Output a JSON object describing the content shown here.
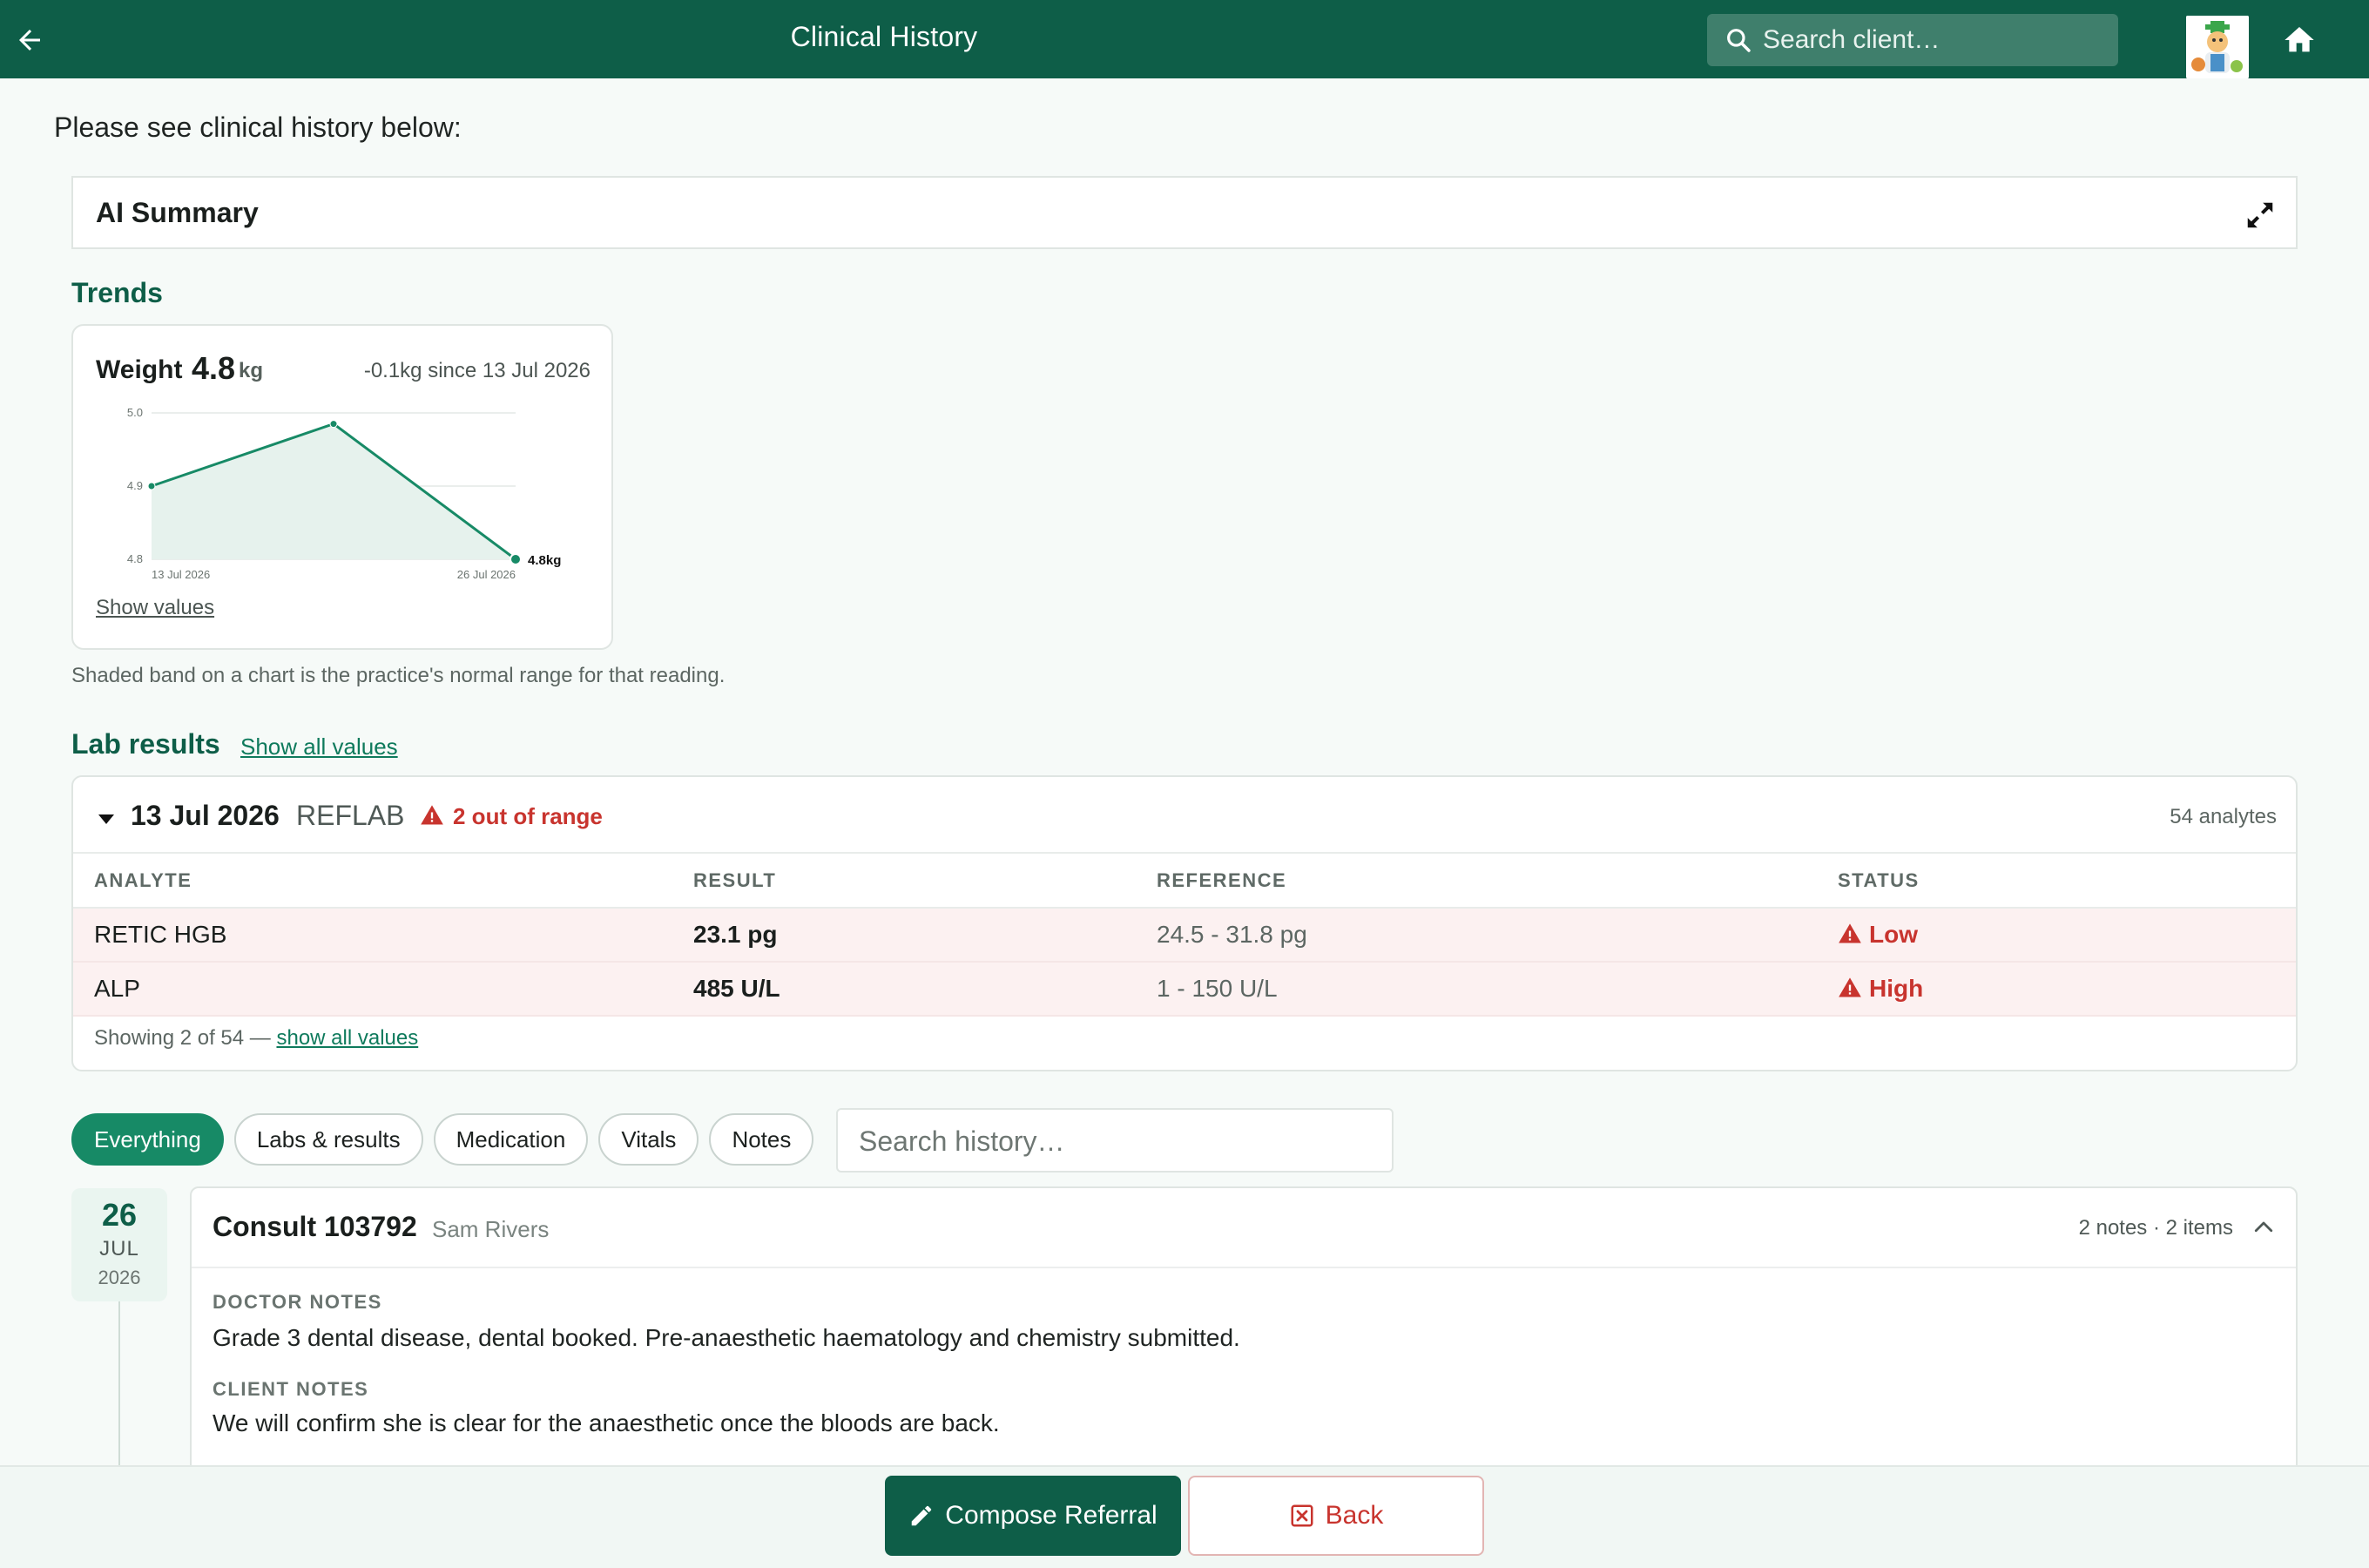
{
  "header": {
    "title": "Clinical History",
    "search_placeholder": "Search client…"
  },
  "intro": "Please see clinical history below:",
  "ai_summary": {
    "label": "AI Summary"
  },
  "trends": {
    "title": "Trends",
    "weight": {
      "label": "Weight",
      "value": "4.8",
      "unit": "kg",
      "delta": "-0.1kg since 13 Jul 2026",
      "show_values": "Show values",
      "end_label": "4.8kg"
    },
    "footnote": "Shaded band on a chart is the practice's normal range for that reading."
  },
  "chart_data": {
    "type": "line",
    "x": [
      "13 Jul 2026",
      "19 Jul 2026",
      "26 Jul 2026"
    ],
    "series": [
      {
        "values": [
          4.9,
          4.985,
          4.8
        ]
      }
    ],
    "ylim": [
      4.8,
      5.0
    ],
    "yticks": [
      "5.0",
      "4.9",
      "4.8"
    ],
    "xtick_labels": [
      "13 Jul 2026",
      "26 Jul 2026"
    ],
    "grid": true,
    "normal_range_band": true,
    "color": "#178a66"
  },
  "lab_results": {
    "title": "Lab results",
    "show_all": "Show all values",
    "panel": {
      "date": "13 Jul 2026",
      "source": "REFLAB",
      "out_of_range": "2 out of range",
      "analyte_count": "54 analytes",
      "columns": [
        "ANALYTE",
        "RESULT",
        "REFERENCE",
        "STATUS"
      ],
      "rows": [
        {
          "analyte": "RETIC HGB",
          "result": "23.1 pg",
          "reference": "24.5 - 31.8 pg",
          "status": "Low"
        },
        {
          "analyte": "ALP",
          "result": "485 U/L",
          "reference": "1 - 150 U/L",
          "status": "High"
        }
      ],
      "showing": "Showing 2 of 54 —",
      "show_all_lower": "show all values"
    }
  },
  "filters": {
    "chips": [
      "Everything",
      "Labs & results",
      "Medication",
      "Vitals",
      "Notes"
    ],
    "active": "Everything",
    "search_placeholder": "Search history…"
  },
  "timeline": {
    "date": {
      "day": "26",
      "month": "JUL",
      "year": "2026"
    },
    "consult": {
      "title": "Consult 103792",
      "author": "Sam Rivers",
      "counts": "2 notes · 2 items",
      "doctor_notes_label": "DOCTOR NOTES",
      "doctor_notes": "Grade 3 dental disease, dental booked. Pre-anaesthetic haematology and chemistry submitted.",
      "client_notes_label": "CLIENT NOTES",
      "client_notes": "We will confirm she is clear for the anaesthetic once the bloods are back."
    }
  },
  "footer": {
    "compose": "Compose Referral",
    "back": "Back"
  },
  "colors": {
    "brand": "#0e5e48",
    "accent": "#178a66",
    "danger": "#c8342e"
  }
}
